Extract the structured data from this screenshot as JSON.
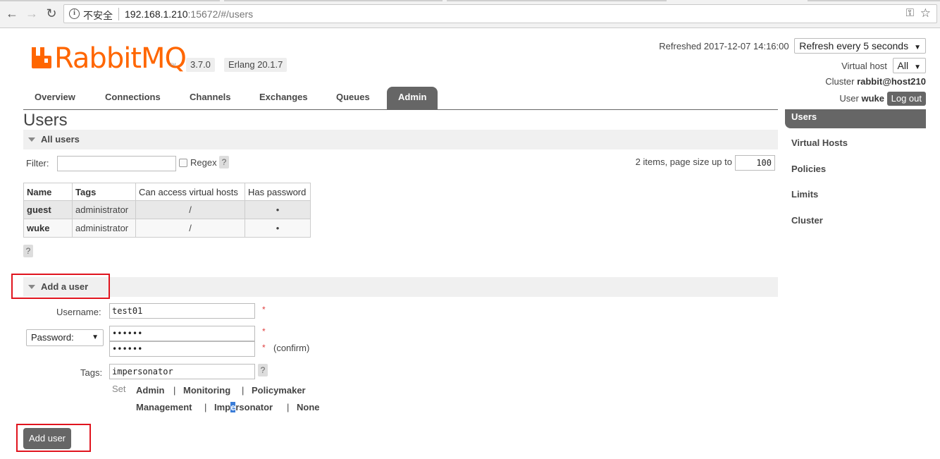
{
  "browser": {
    "security_label": "不安全",
    "url_host": "192.168.1.210",
    "url_rest": ":15672/#/users"
  },
  "header": {
    "logo_text": "RabbitMQ",
    "logo_tm": "TM",
    "version": "3.7.0",
    "erlang": "Erlang 20.1.7",
    "refreshed_label": "Refreshed 2017-12-07 14:16:00",
    "refresh_select": "Refresh every 5 seconds",
    "vhost_label": "Virtual host",
    "vhost_select": "All",
    "cluster_label": "Cluster",
    "cluster_name": "rabbit@host210",
    "user_label": "User",
    "user_name": "wuke",
    "logout": "Log out"
  },
  "nav": {
    "tabs": [
      "Overview",
      "Connections",
      "Channels",
      "Exchanges",
      "Queues",
      "Admin"
    ],
    "active": "Admin"
  },
  "page": {
    "title": "Users",
    "all_users_title": "All users",
    "filter_label": "Filter:",
    "regex_label": "Regex",
    "help": "?",
    "items_label": "2 items, page size up to",
    "page_size": "100"
  },
  "table": {
    "headers": [
      "Name",
      "Tags",
      "Can access virtual hosts",
      "Has password"
    ],
    "rows": [
      {
        "name": "guest",
        "tags": "administrator",
        "vhosts": "/",
        "has_password": "•"
      },
      {
        "name": "wuke",
        "tags": "administrator",
        "vhosts": "/",
        "has_password": "•"
      }
    ]
  },
  "add_user": {
    "title": "Add a user",
    "username_label": "Username:",
    "username_value": "test01",
    "password_select": "Password:",
    "password_value": "••••••",
    "confirm_value": "••••••",
    "required": "*",
    "confirm_label": "(confirm)",
    "tags_label": "Tags:",
    "tags_value": "impersonator",
    "set_label": "Set",
    "tag_options": [
      "Admin",
      "Monitoring",
      "Policymaker",
      "Management",
      "Impersonator",
      "None"
    ],
    "separator": "|",
    "submit": "Add user"
  },
  "sidebar": {
    "items": [
      "Users",
      "Virtual Hosts",
      "Policies",
      "Limits",
      "Cluster"
    ],
    "active": "Users"
  },
  "colors": {
    "brand": "#ff6600",
    "tab_active": "#666666",
    "annotation_red": "#e0141e"
  }
}
